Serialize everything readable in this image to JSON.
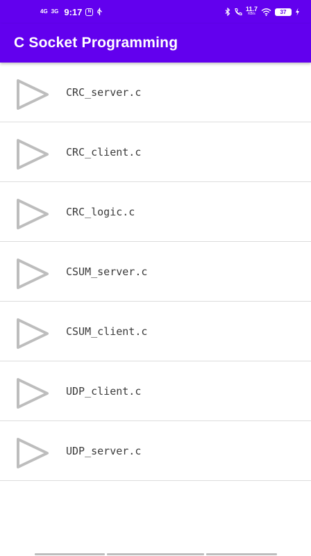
{
  "status_bar": {
    "network_1": "4G",
    "network_2": "3G",
    "time": "9:17",
    "sim_label": "N",
    "speed_value": "11.7",
    "speed_unit": "KB/s",
    "battery": "37",
    "icons": [
      "usb-icon",
      "bluetooth-icon",
      "call-icon",
      "wifi-icon",
      "charging-icon"
    ]
  },
  "app_bar": {
    "title": "C Socket Programming",
    "color": "#6200ee"
  },
  "files": [
    {
      "name": "CRC_server.c"
    },
    {
      "name": "CRC_client.c"
    },
    {
      "name": "CRC_logic.c"
    },
    {
      "name": "CSUM_server.c"
    },
    {
      "name": "CSUM_client.c"
    },
    {
      "name": "UDP_client.c"
    },
    {
      "name": "UDP_server.c"
    }
  ],
  "colors": {
    "primary": "#6200ee",
    "divider": "#dcdcdc",
    "icon": "#bdbdbd",
    "text": "#3a3a3a"
  }
}
